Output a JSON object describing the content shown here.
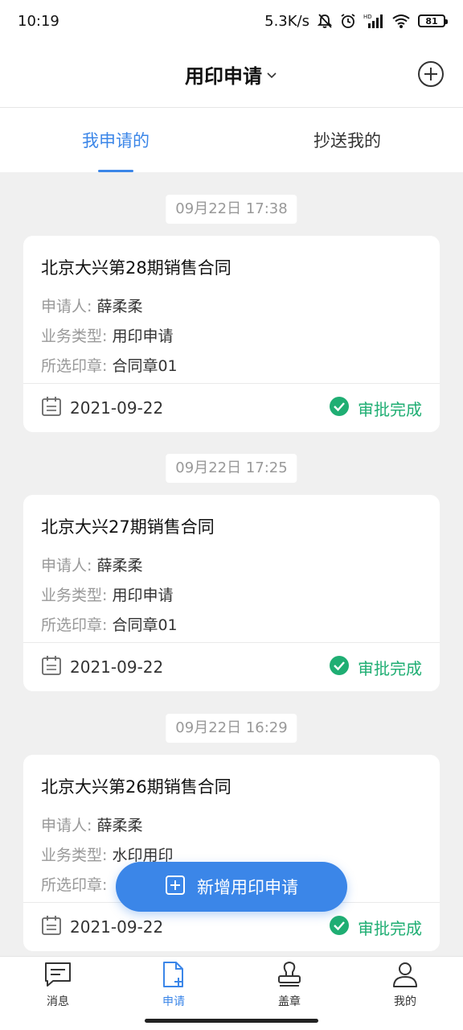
{
  "status_bar": {
    "time": "10:19",
    "network_speed": "5.3K/s",
    "battery": "81",
    "icons": [
      "mute-icon",
      "alarm-icon",
      "hd-icon",
      "signal-icon",
      "wifi-icon",
      "battery-icon"
    ]
  },
  "header": {
    "title": "用印申请"
  },
  "tabs": [
    {
      "label": "我申请的"
    },
    {
      "label": "抄送我的"
    }
  ],
  "field_labels": {
    "applicant": "申请人:",
    "business_type": "业务类型:",
    "seal": "所选印章:"
  },
  "groups": [
    {
      "datetime": "09月22日 17:38",
      "title": "北京大兴第28期销售合同",
      "applicant": "薛柔柔",
      "business_type": "用印申请",
      "seal": "合同章01",
      "date": "2021-09-22",
      "status": "审批完成"
    },
    {
      "datetime": "09月22日 17:25",
      "title": "北京大兴27期销售合同",
      "applicant": "薛柔柔",
      "business_type": "用印申请",
      "seal": "合同章01",
      "date": "2021-09-22",
      "status": "审批完成"
    },
    {
      "datetime": "09月22日 16:29",
      "title": "北京大兴第26期销售合同",
      "applicant": "薛柔柔",
      "business_type": "水印用印",
      "seal": "",
      "date": "2021-09-22",
      "status": "审批完成"
    }
  ],
  "fab": {
    "label": "新增用印申请"
  },
  "bottom_nav": [
    {
      "label": "消息"
    },
    {
      "label": "申请"
    },
    {
      "label": "盖章"
    },
    {
      "label": "我的"
    }
  ],
  "colors": {
    "accent": "#3b86e8",
    "success": "#1fae73"
  }
}
